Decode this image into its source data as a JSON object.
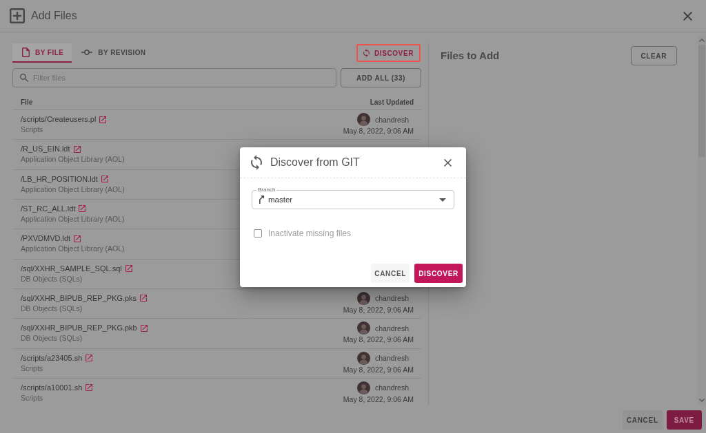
{
  "window": {
    "title": "Add Files"
  },
  "left_panel": {
    "tabs": [
      {
        "label": "BY FILE",
        "kind": "file",
        "selected": true
      },
      {
        "label": "BY REVISION",
        "kind": "revision",
        "selected": false
      }
    ],
    "discover_button": {
      "label": "DISCOVER",
      "highlighted": true
    },
    "filter": {
      "placeholder": "Filter files"
    },
    "add_all_button": {
      "label": "ADD ALL (33)"
    },
    "table": {
      "columns": [
        "File",
        "Last Updated"
      ],
      "rows": [
        {
          "path": "/scripts/Createusers.pl",
          "category": "Scripts",
          "user": "chandresh",
          "updated": "May 8, 2022, 9:06 AM"
        },
        {
          "path": "/R_US_EIN.ldt",
          "category": "Application Object Library (AOL)"
        },
        {
          "path": "/LB_HR_POSITION.ldt",
          "category": "Application Object Library (AOL)"
        },
        {
          "path": "/ST_RC_ALL.ldt",
          "category": "Application Object Library (AOL)"
        },
        {
          "path": "/PXVDMVD.ldt",
          "category": "Application Object Library (AOL)"
        },
        {
          "path": "/sql/XXHR_SAMPLE_SQL.sql",
          "category": "DB Objects (SQLs)"
        },
        {
          "path": "/sql/XXHR_BIPUB_REP_PKG.pks",
          "category": "DB Objects (SQLs)",
          "user": "chandresh",
          "updated": "May 8, 2022, 9:06 AM"
        },
        {
          "path": "/sql/XXHR_BIPUB_REP_PKG.pkb",
          "category": "DB Objects (SQLs)",
          "user": "chandresh",
          "updated": "May 8, 2022, 9:06 AM"
        },
        {
          "path": "/scripts/a23405.sh",
          "category": "Scripts",
          "user": "chandresh",
          "updated": "May 8, 2022, 9:06 AM"
        },
        {
          "path": "/scripts/a10001.sh",
          "category": "Scripts",
          "user": "chandresh",
          "updated": "May 8, 2022, 9:06 AM"
        }
      ]
    }
  },
  "right_panel": {
    "title": "Files to Add",
    "clear_button": {
      "label": "CLEAR"
    }
  },
  "footer": {
    "buttons": [
      {
        "label": "CANCEL",
        "kind": "cancel"
      },
      {
        "label": "SAVE",
        "kind": "save"
      }
    ]
  },
  "dialog": {
    "title": "Discover from GIT",
    "branch": {
      "label": "Branch",
      "value": "master"
    },
    "checkbox": {
      "label": "Inactivate missing files",
      "checked": false
    },
    "buttons": [
      {
        "label": "CANCEL",
        "kind": "cancel"
      },
      {
        "label": "DISCOVER",
        "kind": "discover"
      }
    ]
  }
}
